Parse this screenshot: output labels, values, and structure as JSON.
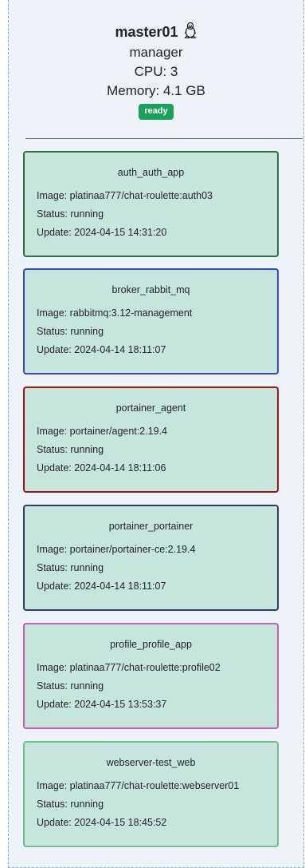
{
  "node": {
    "name": "master01",
    "os_icon": "linux-penguin-icon",
    "role": "manager",
    "cpu": "CPU: 3",
    "memory": "Memory: 4.1 GB",
    "status": "ready"
  },
  "services": [
    {
      "name": "auth_auth_app",
      "image": "Image: platinaa777/chat-roulette:auth03",
      "status": "Status: running",
      "update": "Update: 2024-04-15 14:31:20",
      "border_color": "#2d6e47"
    },
    {
      "name": "broker_rabbit_mq",
      "image": "Image: rabbitmq:3.12-management",
      "status": "Status: running",
      "update": "Update: 2024-04-14 18:11:07",
      "border_color": "#3c45c4"
    },
    {
      "name": "portainer_agent",
      "image": "Image: portainer/agent:2.19.4",
      "status": "Status: running",
      "update": "Update: 2024-04-14 18:11:06",
      "border_color": "#a11414"
    },
    {
      "name": "portainer_portainer",
      "image": "Image: portainer/portainer-ce:2.19.4",
      "status": "Status: running",
      "update": "Update: 2024-04-14 18:11:07",
      "border_color": "#343a6b"
    },
    {
      "name": "profile_profile_app",
      "image": "Image: platinaa777/chat-roulette:profile02",
      "status": "Status: running",
      "update": "Update: 2024-04-15 13:53:37",
      "border_color": "#c060c0"
    },
    {
      "name": "webserver-test_web",
      "image": "Image: platinaa777/chat-roulette:webserver01",
      "status": "Status: running",
      "update": "Update: 2024-04-15 18:45:52",
      "border_color": "#6fbf8f"
    }
  ]
}
